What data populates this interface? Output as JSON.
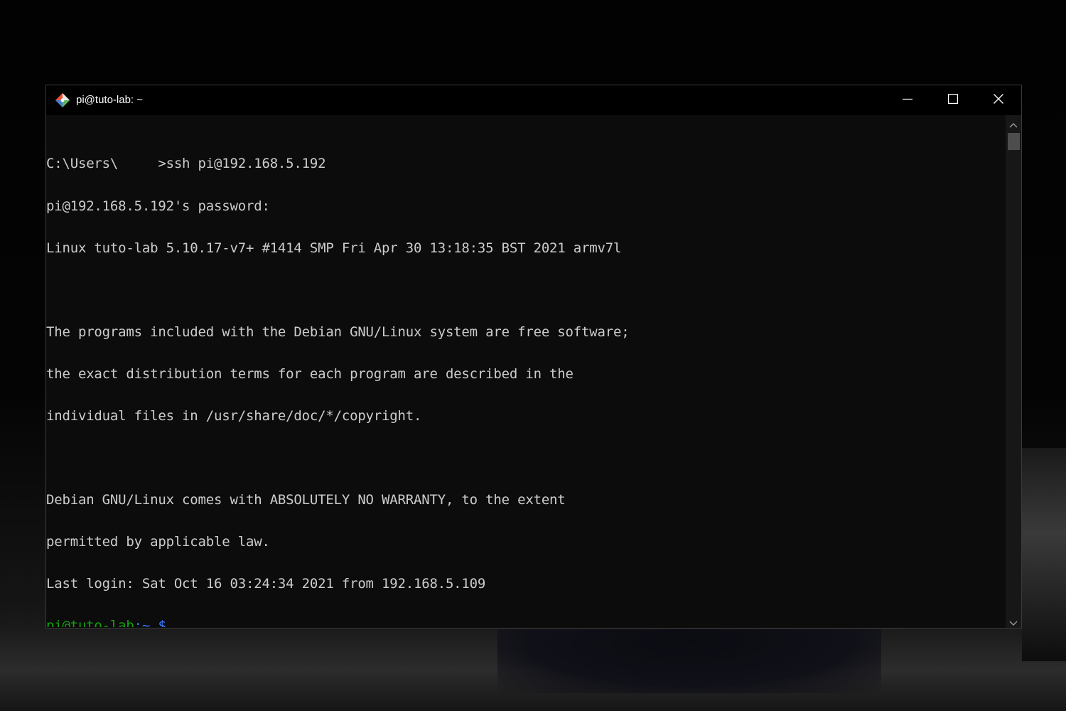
{
  "window": {
    "title": "pi@tuto-lab: ~",
    "icons": {
      "app": "git-bash-diamond-icon",
      "minimize": "minimize-icon",
      "maximize": "maximize-icon",
      "close": "close-icon"
    }
  },
  "terminal": {
    "lines": [
      "C:\\Users\\     >ssh pi@192.168.5.192",
      "pi@192.168.5.192's password:",
      "Linux tuto-lab 5.10.17-v7+ #1414 SMP Fri Apr 30 13:18:35 BST 2021 armv7l",
      "",
      "The programs included with the Debian GNU/Linux system are free software;",
      "the exact distribution terms for each program are described in the",
      "individual files in /usr/share/doc/*/copyright.",
      "",
      "Debian GNU/Linux comes with ABSOLUTELY NO WARRANTY, to the extent",
      "permitted by applicable law.",
      "Last login: Sat Oct 16 03:24:34 2021 from 192.168.5.109"
    ],
    "prompt": {
      "user_host": "pi@tuto-lab",
      "path": ":~ $",
      "user_color": "#13a10e",
      "path_color": "#3b78ff"
    }
  },
  "colors": {
    "terminal_bg": "#0c0c0c",
    "terminal_fg": "#cccccc",
    "titlebar_bg": "#000000"
  }
}
